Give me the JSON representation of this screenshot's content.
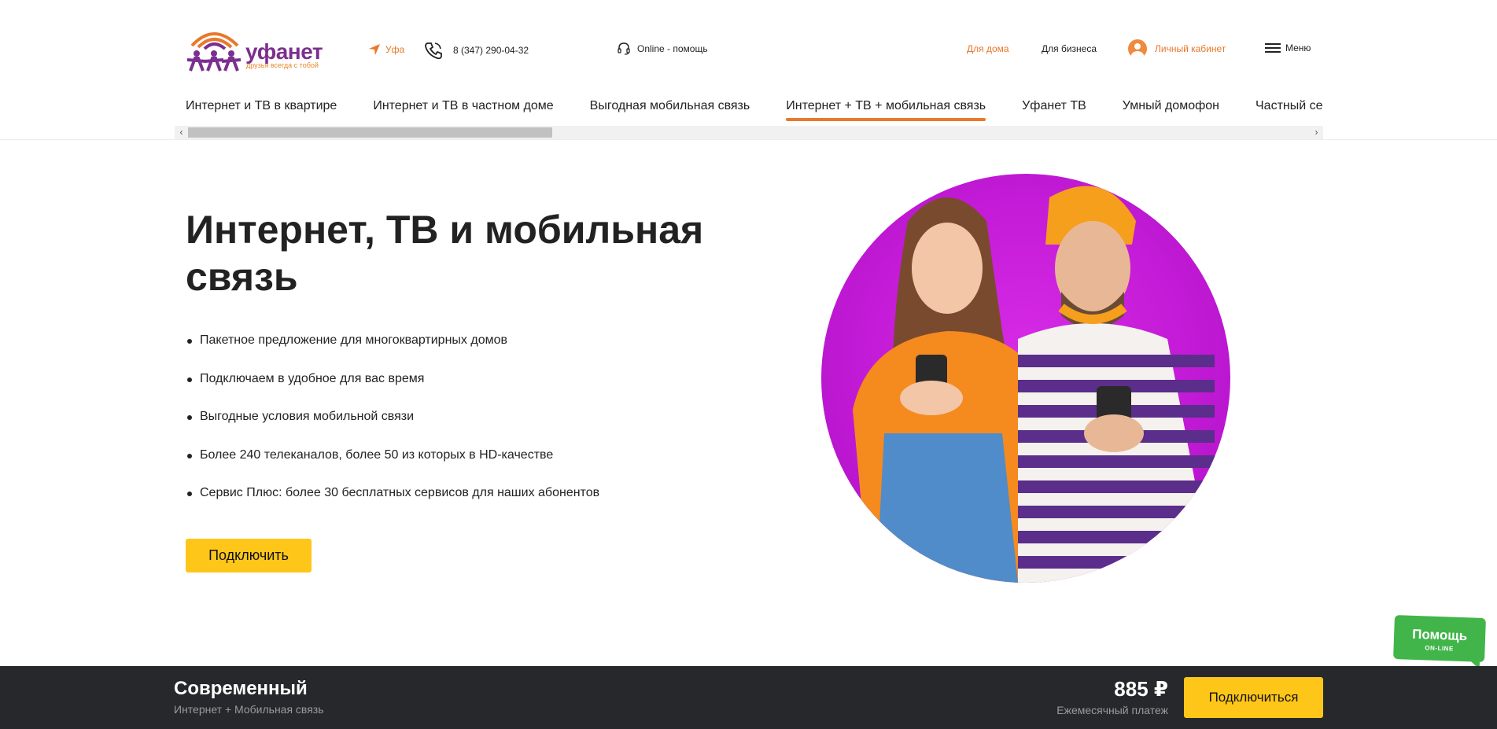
{
  "brand": {
    "name": "уфанет",
    "tagline": "друзья всегда с тобой",
    "colors": {
      "purple": "#7b2f8f",
      "orange": "#e9782a",
      "yellow": "#ffc61a",
      "green": "#41b54a",
      "dark": "#27282c"
    }
  },
  "header": {
    "city": "Уфа",
    "phone": "8 (347) 290-04-32",
    "online_help": "Online - помощь",
    "links": [
      {
        "label": "Для дома",
        "active": true
      },
      {
        "label": "Для бизнеса",
        "active": false
      }
    ],
    "cabinet_label": "Личный кабинет",
    "menu_label": "Меню"
  },
  "tabs": [
    {
      "label": "Интернет и ТВ в квартире"
    },
    {
      "label": "Интернет и ТВ в частном доме"
    },
    {
      "label": "Выгодная мобильная связь"
    },
    {
      "label": "Интернет + ТВ + мобильная связь",
      "active": true
    },
    {
      "label": "Уфанет ТВ"
    },
    {
      "label": "Умный домофон"
    },
    {
      "label": "Частный сектор"
    }
  ],
  "hero": {
    "title": "Интернет, ТВ и мобильная связь",
    "bullets": [
      "Пакетное предложение для многоквартирных домов",
      "Подключаем в удобное для вас время",
      "Выгодные условия мобильной связи",
      "Более 240 телеканалов, более 50 из которых в HD-качестве",
      "Сервис Плюс: более 30 бесплатных сервисов для наших абонентов"
    ],
    "cta_label": "Подключить"
  },
  "help_widget": {
    "title": "Помощь",
    "subtitle": "ON-LINE"
  },
  "bottom_bar": {
    "plan_name": "Современный",
    "plan_desc": "Интернет + Мобильная связь",
    "price": "885 ₽",
    "price_label": "Ежемесячный платеж",
    "connect_label": "Подключиться"
  }
}
